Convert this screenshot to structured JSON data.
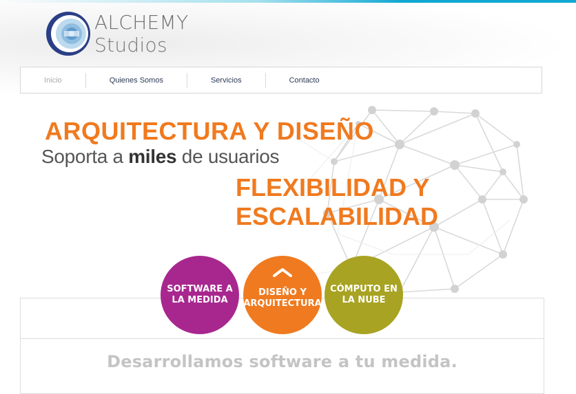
{
  "header": {
    "logo_main": "ALCHEMY",
    "logo_secondary": "Studios",
    "logo_icon": "alchemy-studios-logo-icon"
  },
  "nav": {
    "items": [
      {
        "label": "Inicio"
      },
      {
        "label": "Quienes Somos"
      },
      {
        "label": "Servicios"
      },
      {
        "label": "Contacto"
      }
    ]
  },
  "hero": {
    "title": "ARQUITECTURA Y DISEÑO",
    "subtitle_pre": "Soporta a ",
    "subtitle_bold": "miles",
    "subtitle_post": " de usuarios",
    "flex_line1": "FLEXIBILIDAD Y",
    "flex_line2": "ESCALABILIDAD",
    "accent_color": "#f07a1f"
  },
  "services": [
    {
      "label": "SOFTWARE A LA MEDIDA",
      "color": "#a8278f"
    },
    {
      "label": "DISEÑO Y ARQUITECTURA",
      "color": "#f07a1f",
      "icon": "chevron-up-icon"
    },
    {
      "label": "CÓMPUTO EN LA NUBE",
      "color": "#a8a322"
    }
  ],
  "content": {
    "tagline": "Desarrollamos software a tu medida."
  }
}
